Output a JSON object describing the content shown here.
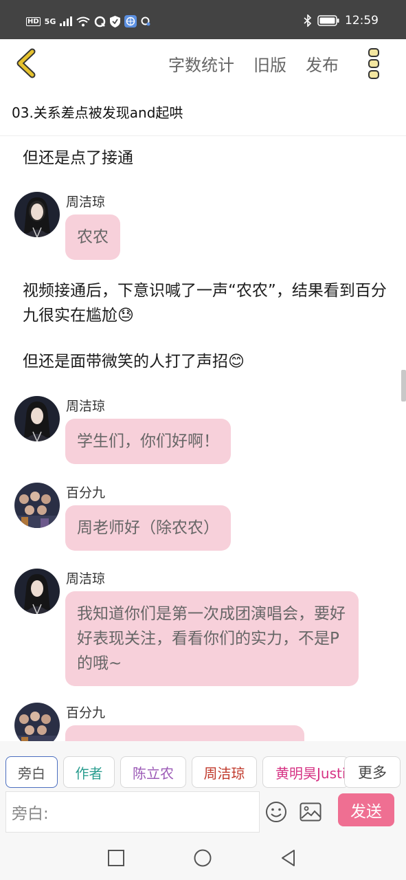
{
  "status_bar": {
    "network": "5G",
    "time": "12:59",
    "icons": [
      "hd-icon",
      "signal-icon",
      "wifi-icon",
      "q-app-icon",
      "shield-icon",
      "browser-icon",
      "search-app-icon",
      "bluetooth-icon",
      "battery-icon"
    ]
  },
  "nav": {
    "word_count": "字数统计",
    "old_version": "旧版",
    "publish": "发布"
  },
  "chapter_title": "03.关系差点被发现and起哄",
  "messages": [
    {
      "type": "narration",
      "text": "但还是点了接通"
    },
    {
      "type": "dialog",
      "speaker": "周洁琼",
      "text": "农农"
    },
    {
      "type": "narration",
      "text": "视频接通后，下意识喊了一声“农农”，结果看到百分九很实在尴尬😓"
    },
    {
      "type": "narration",
      "text": "但还是面带微笑的人打了声招😊"
    },
    {
      "type": "dialog",
      "speaker": "周洁琼",
      "text": "学生们，你们好啊！"
    },
    {
      "type": "dialog",
      "speaker": "百分九",
      "text": "周老师好（除农农）"
    },
    {
      "type": "dialog",
      "speaker": "周洁琼",
      "text": "我知道你们是第一次成团演唱会，要好好表现关注，看看你们的实力，不是P的哦~"
    },
    {
      "type": "dialog",
      "speaker": "百分九",
      "text": ""
    }
  ],
  "roles": [
    {
      "label": "旁白",
      "color": "#555555"
    },
    {
      "label": "作者",
      "color": "#2a9d8f"
    },
    {
      "label": "陈立农",
      "color": "#9b59b6"
    },
    {
      "label": "周洁琼",
      "color": "#c0392b"
    },
    {
      "label": "黄明昊Justin",
      "color": "#d63384"
    }
  ],
  "more_label": "更多",
  "input": {
    "placeholder": "旁白:"
  },
  "send_label": "发送",
  "colors": {
    "bubble": "#f7d0da",
    "send": "#ef6f92",
    "back_arrow": "#e6c22e",
    "status_bar": "#434343"
  }
}
